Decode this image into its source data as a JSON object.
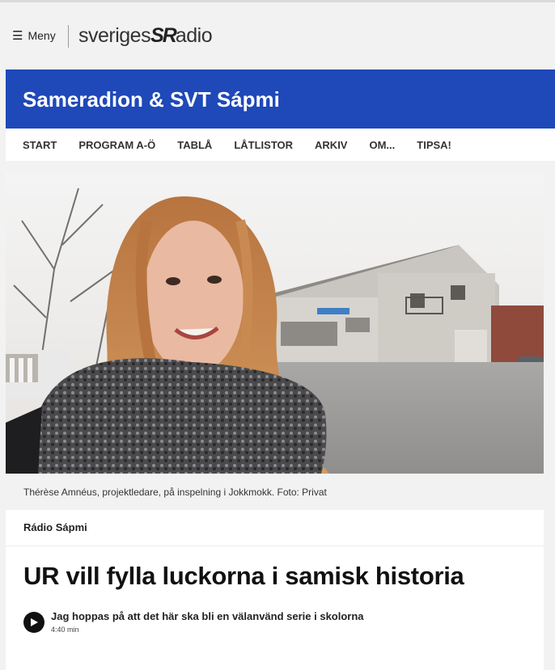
{
  "header": {
    "menu_label": "Meny",
    "menu_icon": "hamburger-icon",
    "logo_part1": "sveriges",
    "logo_part2": "SR",
    "logo_part3": "adio"
  },
  "channel": {
    "title": "Sameradion & SVT Sápmi",
    "brand_color": "#1f48b9"
  },
  "nav": {
    "items": [
      {
        "label": "START"
      },
      {
        "label": "PROGRAM A-Ö"
      },
      {
        "label": "TABLÅ"
      },
      {
        "label": "LÅTLISTOR"
      },
      {
        "label": "ARKIV"
      },
      {
        "label": "OM..."
      },
      {
        "label": "TIPSA!"
      }
    ]
  },
  "article": {
    "image_caption": "Thérèse Amnéus, projektledare, på inspelning i Jokkmokk. Foto: Privat",
    "program": "Rádio Sápmi",
    "headline": "UR vill fylla luckorna i samisk historia",
    "audio": {
      "title": "Jag hoppas på att det här ska bli en välanvänd serie i skolorna",
      "duration": "4:40 min",
      "icon": "play-icon"
    }
  }
}
